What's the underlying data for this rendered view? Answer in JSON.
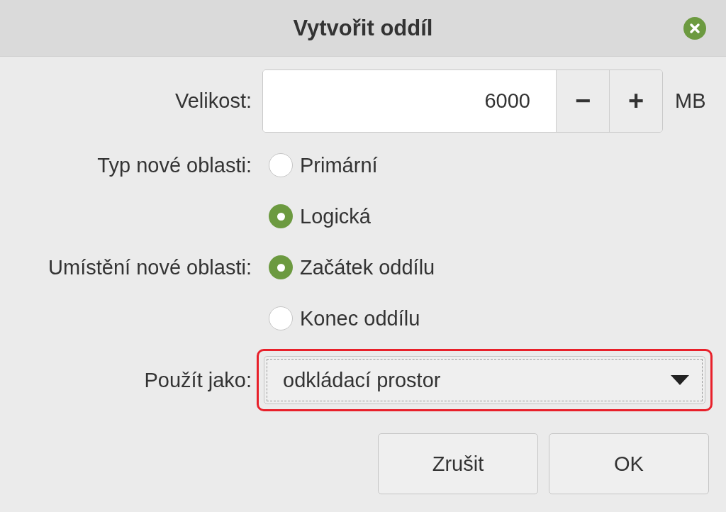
{
  "window": {
    "title": "Vytvořit oddíl"
  },
  "size": {
    "label": "Velikost:",
    "value": "6000",
    "decrement": "−",
    "increment": "+",
    "unit": "MB"
  },
  "partition_type": {
    "label": "Typ nové oblasti:",
    "options": [
      {
        "label": "Primární",
        "selected": false
      },
      {
        "label": "Logická",
        "selected": true
      }
    ]
  },
  "location": {
    "label": "Umístění nové oblasti:",
    "options": [
      {
        "label": "Začátek oddílu",
        "selected": true
      },
      {
        "label": "Konec oddílu",
        "selected": false
      }
    ]
  },
  "use_as": {
    "label": "Použít jako:",
    "value": "odkládací prostor",
    "highlighted": true
  },
  "buttons": [
    "Zrušit",
    "OK"
  ]
}
